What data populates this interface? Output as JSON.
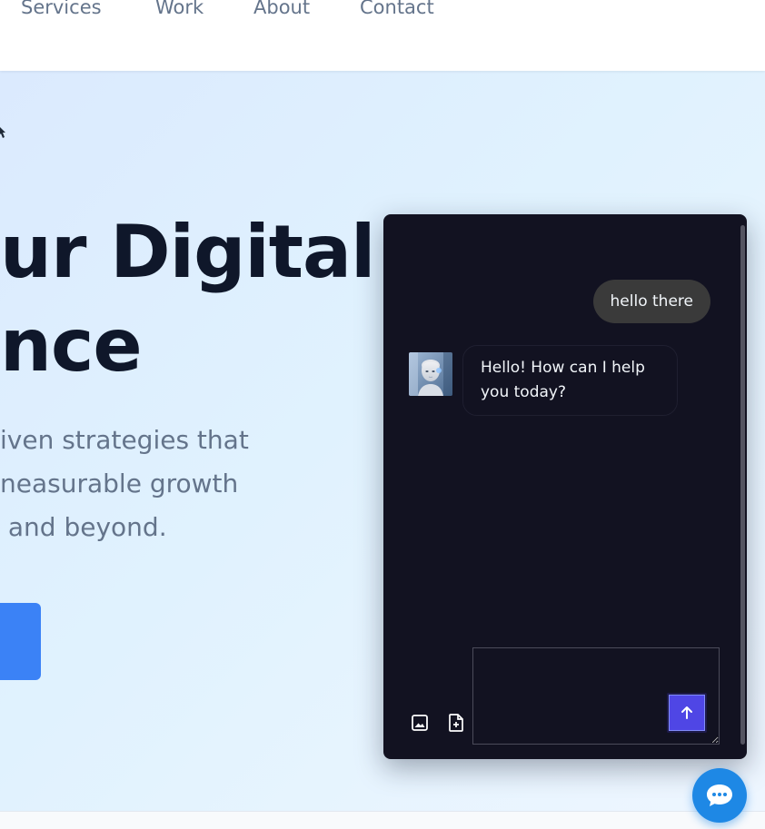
{
  "nav": {
    "items": [
      {
        "label": "Services"
      },
      {
        "label": "Work"
      },
      {
        "label": "About"
      },
      {
        "label": "Contact"
      }
    ]
  },
  "hero": {
    "heading_lines": [
      "ur Digital",
      "nce"
    ],
    "subtitle_lines": [
      "iven strategies that",
      "neasurable growth",
      " and beyond."
    ],
    "cta_label": "",
    "accent_color": "#3b82f6"
  },
  "chat": {
    "messages": [
      {
        "role": "user",
        "text": "hello there"
      },
      {
        "role": "assistant",
        "text": "Hello! How can I help you today?",
        "avatar": "robot-avatar"
      }
    ],
    "input": {
      "value": "",
      "placeholder": ""
    },
    "tools": [
      {
        "icon": "image-upload-icon"
      },
      {
        "icon": "file-add-icon"
      }
    ],
    "send_icon": "arrow-up-icon",
    "background_color": "#121221",
    "send_color": "#4f46e5"
  },
  "launcher": {
    "icon": "chat-bubble-icon",
    "color": "#1e88e5"
  }
}
